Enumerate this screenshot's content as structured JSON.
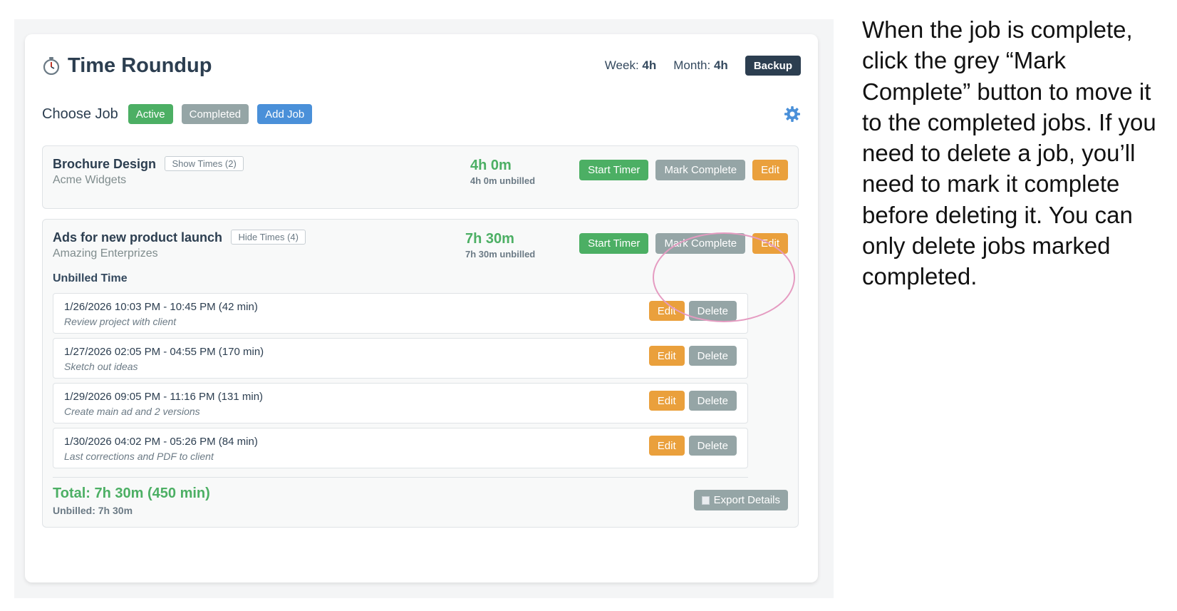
{
  "app": {
    "title": "Time Roundup",
    "week_label": "Week:",
    "week_value": "4h",
    "month_label": "Month:",
    "month_value": "4h",
    "backup_label": "Backup"
  },
  "choose": {
    "label": "Choose Job",
    "active_label": "Active",
    "completed_label": "Completed",
    "add_label": "Add Job"
  },
  "jobs": [
    {
      "name": "Brochure Design",
      "times_toggle": "Show Times (2)",
      "client": "Acme Widgets",
      "total": "4h 0m",
      "unbilled": "4h 0m unbilled",
      "start_label": "Start Timer",
      "complete_label": "Mark Complete",
      "edit_label": "Edit"
    },
    {
      "name": "Ads for new product launch",
      "times_toggle": "Hide Times (4)",
      "client": "Amazing Enterprizes",
      "total": "7h 30m",
      "unbilled": "7h 30m unbilled",
      "start_label": "Start Timer",
      "complete_label": "Mark Complete",
      "edit_label": "Edit",
      "unbilled_title": "Unbilled Time",
      "entries": [
        {
          "range": "1/26/2026 10:03 PM - 10:45 PM (42 min)",
          "note": "Review project with client",
          "edit": "Edit",
          "delete": "Delete"
        },
        {
          "range": "1/27/2026 02:05 PM - 04:55 PM (170 min)",
          "note": "Sketch out ideas",
          "edit": "Edit",
          "delete": "Delete"
        },
        {
          "range": "1/29/2026 09:05 PM - 11:16 PM (131 min)",
          "note": "Create main ad and 2 versions",
          "edit": "Edit",
          "delete": "Delete"
        },
        {
          "range": "1/30/2026 04:02 PM - 05:26 PM (84 min)",
          "note": "Last corrections and PDF to client",
          "edit": "Edit",
          "delete": "Delete"
        }
      ],
      "grand_total": "Total: 7h 30m (450 min)",
      "grand_unbilled": "Unbilled: 7h 30m",
      "export_label": "Export Details"
    }
  ],
  "instructions": {
    "text": "When the job is complete, click the grey “Mark Complete” button to move it to the completed jobs. If you need to delete a job, you’ll need to mark it complete before deleting it. You can only delete jobs marked completed."
  },
  "colors": {
    "green": "#4caf64",
    "grey": "#95a5a6",
    "blue": "#4a90d9",
    "orange": "#eaa03c",
    "dark": "#2c3e50",
    "highlight": "#e59bc1"
  },
  "icons": [
    "stopwatch-icon",
    "gear-icon",
    "clipboard-icon"
  ]
}
